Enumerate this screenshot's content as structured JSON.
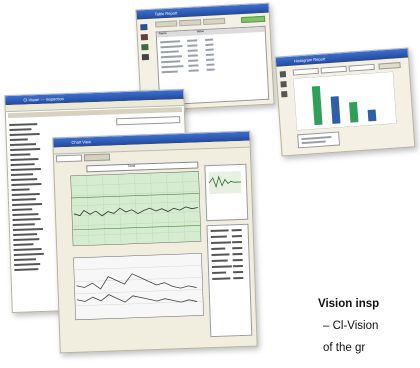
{
  "windows": {
    "table_window": {
      "title": "Table Report",
      "headers": [
        "Name",
        "Value"
      ]
    },
    "bar_window": {
      "title": "Histogram Report"
    },
    "main_window": {
      "title": "Cl-Vision — Inspection"
    },
    "trend_window": {
      "title": "Chart View",
      "chart_title": "Trend"
    }
  },
  "caption": {
    "title": "Vision insp",
    "line1": "– Cl-Vision",
    "line2": "of the gr"
  },
  "colors": {
    "titlebar": "#2d5fb8",
    "chart_green": "#d6ecd0",
    "bar_blue": "#2f5fa6",
    "bar_green": "#2f9f5a"
  },
  "bar_chart": {
    "type": "bar",
    "values": [
      88,
      62,
      46,
      26
    ]
  }
}
